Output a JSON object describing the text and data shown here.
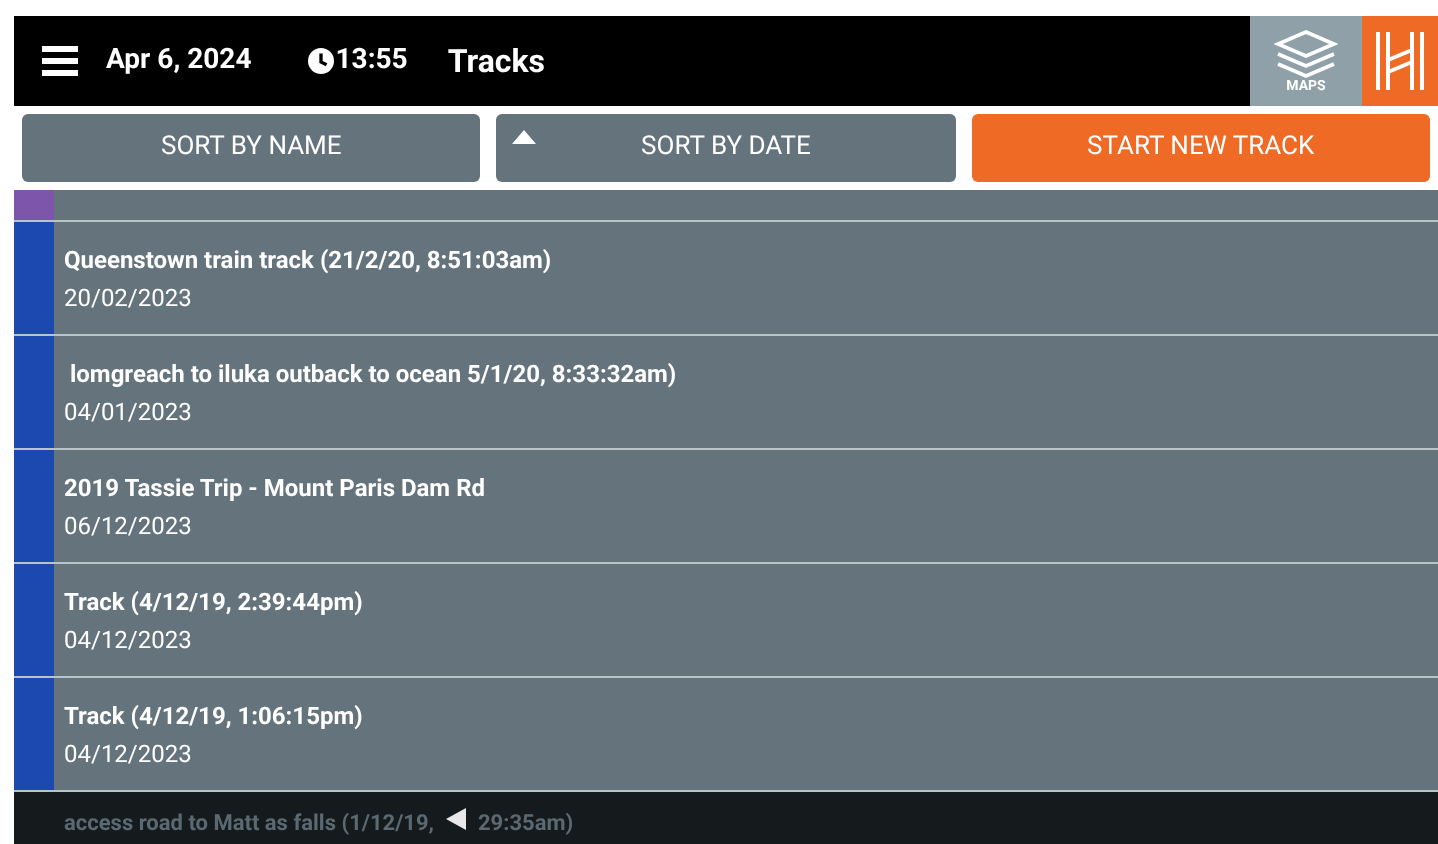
{
  "header": {
    "date": "Apr 6, 2024",
    "time": "13:55",
    "title": "Tracks",
    "maps_label": "MAPS"
  },
  "buttons": [
    {
      "label": "SORT BY NAME",
      "kind": "sort",
      "sorted": false
    },
    {
      "label": "SORT BY DATE",
      "kind": "sort",
      "sorted": true
    },
    {
      "label": "START NEW TRACK",
      "kind": "primary",
      "sorted": false
    }
  ],
  "partial_top_row": {
    "color": "#7d55aa"
  },
  "tracks": [
    {
      "title": "Queenstown train track (21/2/20, 8:51:03am)",
      "date": "20/02/2023",
      "color": "#1c49b0"
    },
    {
      "title": " lomgreach to iluka outback to ocean 5/1/20, 8:33:32am)",
      "date": "04/01/2023",
      "color": "#1c49b0"
    },
    {
      "title": "2019 Tassie Trip - Mount Paris Dam Rd",
      "date": "06/12/2023",
      "color": "#1c49b0"
    },
    {
      "title": "Track (4/12/19, 2:39:44pm)",
      "date": "04/12/2023",
      "color": "#1c49b0"
    },
    {
      "title": "Track (4/12/19, 1:06:15pm)",
      "date": "04/12/2023",
      "color": "#1c49b0"
    }
  ],
  "bottom_bar": {
    "faded_row_title": "access road to Matt as falls (1/12/19,",
    "faded_row_title_end": "29:35am)"
  }
}
